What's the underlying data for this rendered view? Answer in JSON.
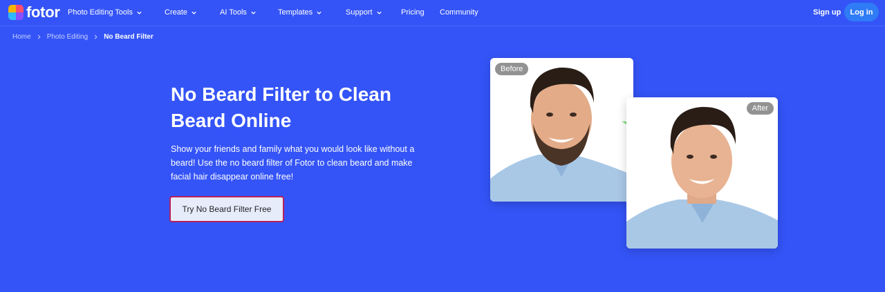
{
  "header": {
    "logo_text": "fotor",
    "nav": [
      {
        "label": "Photo Editing Tools",
        "dropdown": true
      },
      {
        "label": "Create",
        "dropdown": true
      },
      {
        "label": "AI Tools",
        "dropdown": true
      },
      {
        "label": "Templates",
        "dropdown": true
      },
      {
        "label": "Support",
        "dropdown": true
      },
      {
        "label": "Pricing",
        "dropdown": false
      },
      {
        "label": "Community",
        "dropdown": false
      }
    ],
    "signup_label": "Sign up",
    "login_label": "Log in"
  },
  "breadcrumb": [
    "Home",
    "Photo Editing",
    "No Beard Filter"
  ],
  "hero": {
    "title": "No Beard Filter to Clean Beard Online",
    "description": "Show your friends and family what you would look like without a beard! Use the no beard filter of Fotor to clean beard and make facial hair disappear online free!",
    "cta_label": "Try No Beard Filter Free"
  },
  "images": {
    "before_label": "Before",
    "after_label": "After"
  },
  "colors": {
    "background": "#3454f7",
    "login_button": "#2f7cf6",
    "cta_background": "#e7ecfb",
    "cta_border": "#b8205a",
    "arrow": "#7ee07a"
  }
}
